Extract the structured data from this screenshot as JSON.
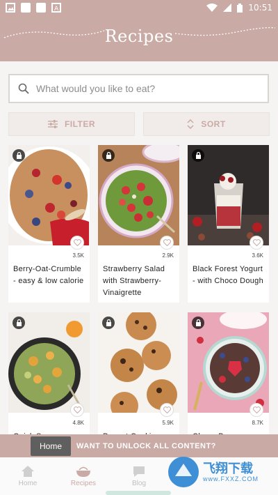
{
  "status_bar": {
    "time": "10:51"
  },
  "header": {
    "title": "Recipes"
  },
  "search": {
    "placeholder": "What would you like to eat?"
  },
  "filter_label": "FILTER",
  "sort_label": "SORT",
  "recipes": [
    {
      "title": "Berry-Oat-Crumble - easy & low calorie",
      "likes": "3.5K"
    },
    {
      "title": "Strawberry Salad with Strawberry-Vinaigrette",
      "likes": "2.9K"
    },
    {
      "title": "Black Forest Yogurt - with Choco Dough",
      "likes": "3.6K"
    },
    {
      "title": "Quick Summer...",
      "likes": "4.8K"
    },
    {
      "title": "Peanut Cookies...",
      "likes": "5.9K"
    },
    {
      "title": "Choco-Berry...",
      "likes": "8.7K"
    }
  ],
  "unlock_banner": {
    "text": "WANT TO UNLOCK ALL CONTENT?"
  },
  "tooltip": {
    "text": "Home"
  },
  "nav": {
    "home": "Home",
    "recipes": "Recipes",
    "blog": "Blog"
  },
  "watermark": {
    "brand": "飞翔下载",
    "url": "www.FXXZ.COM"
  }
}
